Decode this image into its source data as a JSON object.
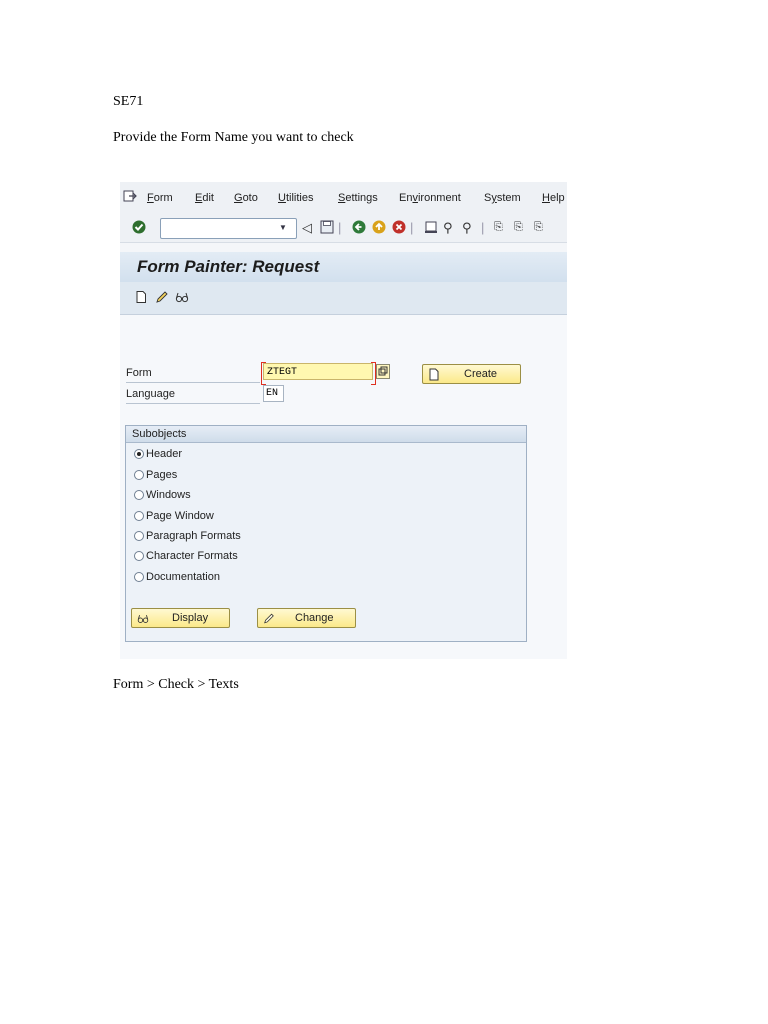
{
  "doc": {
    "line1": "SE71",
    "line2": "Provide the Form Name you want to check",
    "line3": "Form > Check > Texts"
  },
  "sap": {
    "menu": [
      {
        "key": "F",
        "rest": "orm"
      },
      {
        "key": "E",
        "rest": "dit"
      },
      {
        "key": "G",
        "rest": "oto"
      },
      {
        "key": "U",
        "rest": "tilities"
      },
      {
        "key": "S",
        "rest": "ettings"
      },
      {
        "pre": "En",
        "key": "v",
        "rest": "ironment"
      },
      {
        "pre": "S",
        "key": "y",
        "rest": "stem"
      },
      {
        "key": "H",
        "rest": "elp"
      }
    ],
    "title": "Form Painter: Request",
    "form_label": "Form",
    "form_value": "ZTEGT",
    "language_label": "Language",
    "language_value": "EN",
    "create_label": "Create",
    "subobjects_title": "Subobjects",
    "radios": [
      "Header",
      "Pages",
      "Windows",
      "Page Window",
      "Paragraph Formats",
      "Character Formats",
      "Documentation"
    ],
    "selected_radio": "Header",
    "display_label": "Display",
    "change_label": "Change",
    "colors": {
      "title_bar": "#d2e0ee",
      "input_required": "#fff8b0",
      "button": "#fbe98a"
    }
  }
}
